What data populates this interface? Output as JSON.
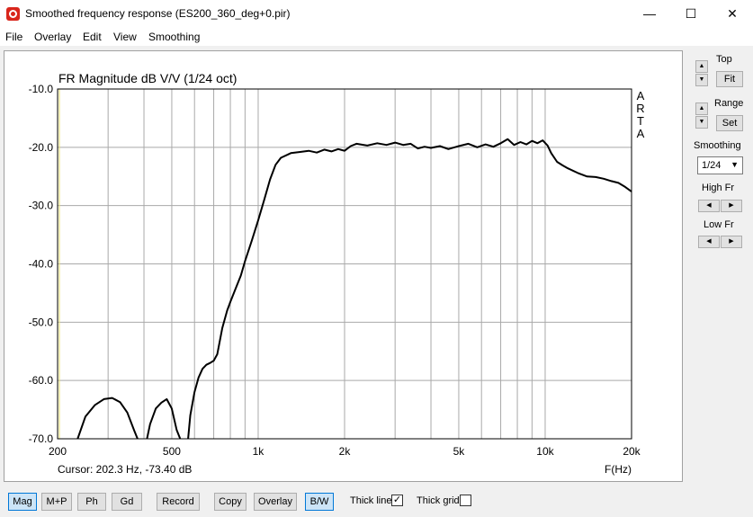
{
  "window": {
    "title": "Smoothed frequency response (ES200_360_deg+0.pir)",
    "minimize": "—",
    "maximize": "☐",
    "close": "✕"
  },
  "menu": [
    "File",
    "Overlay",
    "Edit",
    "View",
    "Smoothing"
  ],
  "plot": {
    "cursor": "Cursor: 202.3 Hz, -73.40 dB",
    "fhz_label": "F(Hz)",
    "watermark": [
      "A",
      "R",
      "T",
      "A"
    ]
  },
  "chart_data": {
    "type": "line",
    "title": "FR Magnitude dB V/V (1/24 oct)",
    "xlabel": "F(Hz)",
    "ylabel": "",
    "xscale": "log",
    "xlim": [
      200,
      20000
    ],
    "ylim": [
      -70,
      -10
    ],
    "x_ticks": [
      200,
      500,
      1000,
      2000,
      5000,
      10000,
      20000
    ],
    "x_tick_labels": [
      "200",
      "500",
      "1k",
      "2k",
      "5k",
      "10k",
      "20k"
    ],
    "y_ticks": [
      -10,
      -20,
      -30,
      -40,
      -50,
      -60,
      -70
    ],
    "y_tick_labels": [
      "-10.0",
      "-20.0",
      "-30.0",
      "-40.0",
      "-50.0",
      "-60.0",
      "-70.0"
    ],
    "grid": true,
    "series": [
      {
        "segments": [
          {
            "x": [
              235,
              250,
              270,
              290,
              310,
              330,
              350,
              370,
              380
            ],
            "y": [
              -70.0,
              -66.2,
              -64.2,
              -63.2,
              -63.0,
              -63.7,
              -65.5,
              -68.6,
              -70.0
            ]
          },
          {
            "x": [
              410,
              420,
              440,
              460,
              480,
              500,
              520,
              535
            ],
            "y": [
              -70.0,
              -67.5,
              -64.8,
              -63.8,
              -63.2,
              -64.8,
              -68.5,
              -70.0
            ]
          },
          {
            "x": [
              570,
              580,
              600,
              620,
              640,
              660,
              680,
              700,
              720,
              750,
              780,
              800,
              830,
              870,
              900,
              950,
              1000,
              1050,
              1100,
              1150,
              1200,
              1300,
              1400,
              1500,
              1600,
              1700,
              1800,
              1900,
              2000,
              2100,
              2200,
              2400,
              2600,
              2800,
              3000,
              3200,
              3400,
              3600,
              3800,
              4000,
              4300,
              4600,
              5000,
              5400,
              5800,
              6200,
              6600,
              7000,
              7400,
              7800,
              8200,
              8600,
              9000,
              9400,
              9800,
              10200,
              10500,
              11000,
              11500,
              12000,
              13000,
              14000,
              15000,
              16000,
              17000,
              18000,
              19000,
              20000
            ],
            "y": [
              -70.0,
              -66.0,
              -62.0,
              -59.5,
              -58.0,
              -57.3,
              -57.0,
              -56.6,
              -55.5,
              -51.0,
              -48.0,
              -46.5,
              -44.5,
              -42.0,
              -39.5,
              -36.0,
              -32.5,
              -29.0,
              -25.5,
              -23.0,
              -21.8,
              -21.0,
              -20.8,
              -20.6,
              -20.9,
              -20.4,
              -20.7,
              -20.3,
              -20.6,
              -19.8,
              -19.4,
              -19.7,
              -19.3,
              -19.6,
              -19.2,
              -19.6,
              -19.4,
              -20.2,
              -19.9,
              -20.1,
              -19.8,
              -20.3,
              -19.8,
              -19.4,
              -20.0,
              -19.5,
              -19.9,
              -19.3,
              -18.6,
              -19.6,
              -19.1,
              -19.5,
              -18.9,
              -19.3,
              -18.8,
              -19.7,
              -21.0,
              -22.5,
              -23.1,
              -23.6,
              -24.4,
              -25.0,
              -25.1,
              -25.4,
              -25.8,
              -26.1,
              -26.8,
              -27.6
            ]
          }
        ]
      }
    ]
  },
  "sidebar": {
    "top_label": "Top",
    "fit": "Fit",
    "range_label": "Range",
    "set": "Set",
    "smoothing_label": "Smoothing",
    "smoothing_value": "1/24",
    "high_fr_label": "High Fr",
    "low_fr_label": "Low Fr"
  },
  "bottom": {
    "mag": "Mag",
    "mp": "M+P",
    "ph": "Ph",
    "gd": "Gd",
    "record": "Record",
    "copy": "Copy",
    "overlay": "Overlay",
    "bw": "B/W",
    "thick_line": "Thick line",
    "thick_line_checked": true,
    "thick_grid": "Thick grid",
    "thick_grid_checked": false
  }
}
